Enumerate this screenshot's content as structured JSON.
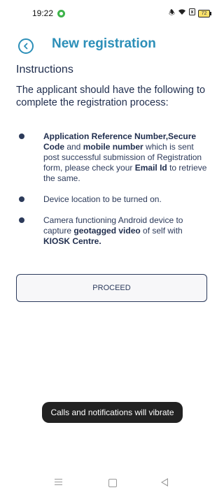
{
  "status_bar": {
    "time": "19:22",
    "battery": "72",
    "icons": [
      "vibrate-icon",
      "wifi-icon",
      "sim-icon",
      "battery-icon"
    ]
  },
  "header": {
    "title": "New registration",
    "back_icon": "chevron-left-circle-icon"
  },
  "instructions": {
    "title": "Instructions",
    "intro": "The applicant should have the following to complete the registration process:",
    "items": [
      {
        "parts": [
          {
            "text": "Application Reference Number,Secure Code",
            "bold": true
          },
          {
            "text": " and ",
            "bold": false
          },
          {
            "text": "mobile number",
            "bold": true
          },
          {
            "text": " which is sent post successful submission of Registration form, please check your ",
            "bold": false
          },
          {
            "text": "Email Id",
            "bold": true
          },
          {
            "text": " to retrieve the same.",
            "bold": false
          }
        ]
      },
      {
        "parts": [
          {
            "text": "Device location to be turned on.",
            "bold": false
          }
        ]
      },
      {
        "parts": [
          {
            "text": "Camera functioning Android device to capture ",
            "bold": false
          },
          {
            "text": "geotagged video",
            "bold": true
          },
          {
            "text": " of self with ",
            "bold": false
          },
          {
            "text": "KIOSK Centre.",
            "bold": true
          }
        ]
      }
    ]
  },
  "proceed_label": "PROCEED",
  "toast": "Calls and notifications will vibrate",
  "colors": {
    "accent": "#2c8fb8",
    "text": "#1f2d4d",
    "button_border": "#2b3a5c",
    "toast_bg": "#222222"
  }
}
